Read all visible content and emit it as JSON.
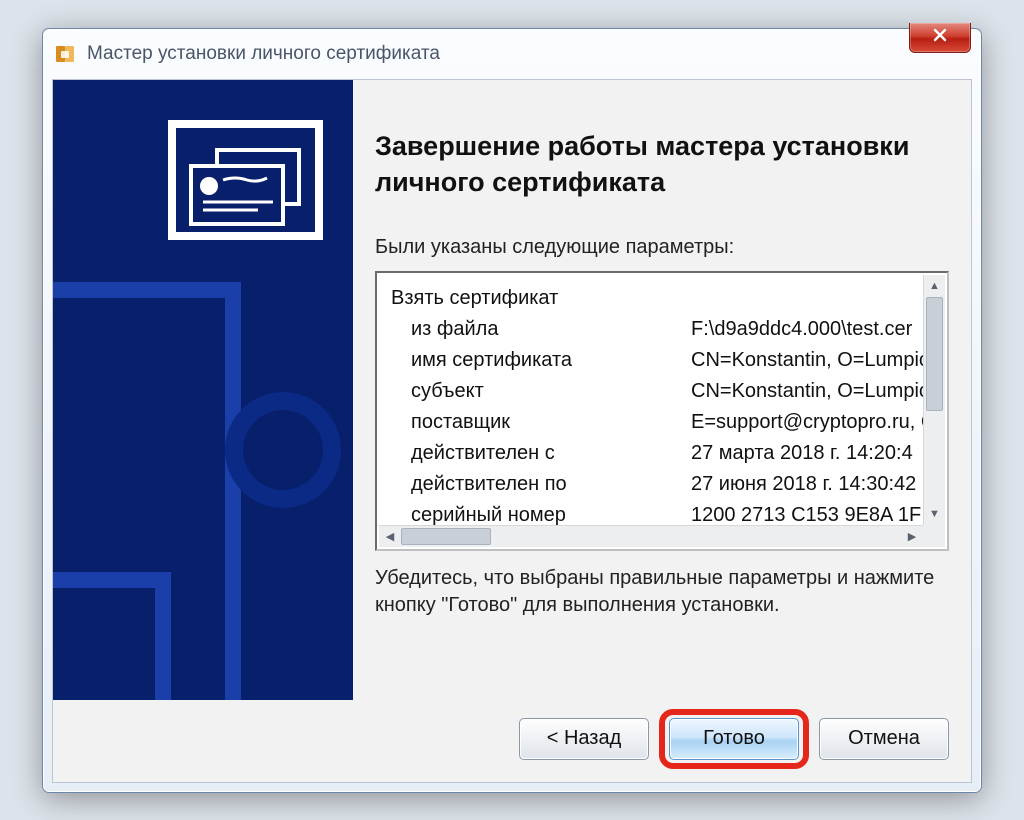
{
  "window": {
    "title": "Мастер установки личного сертификата"
  },
  "main": {
    "heading": "Завершение работы мастера установки личного сертификата",
    "intro": "Были указаны следующие параметры:",
    "group_header": "Взять сертификат",
    "params": [
      {
        "key": "из файла",
        "val": "F:\\d9a9ddc4.000\\test.cer"
      },
      {
        "key": "имя сертификата",
        "val": "CN=Konstantin, O=Lumpic"
      },
      {
        "key": "субъект",
        "val": "CN=Konstantin, O=Lumpic"
      },
      {
        "key": "поставщик",
        "val": "E=support@cryptopro.ru, C"
      },
      {
        "key": "действителен с",
        "val": "27 марта 2018 г. 14:20:4"
      },
      {
        "key": "действителен по",
        "val": "27 июня 2018 г. 14:30:42"
      },
      {
        "key": "серийный номер",
        "val": "1200 2713 C153 9E8A 1F"
      }
    ],
    "hint": "Убедитесь, что выбраны правильные параметры и нажмите кнопку \"Готово\" для выполнения установки."
  },
  "buttons": {
    "back": "< Назад",
    "finish": "Готово",
    "cancel": "Отмена"
  }
}
